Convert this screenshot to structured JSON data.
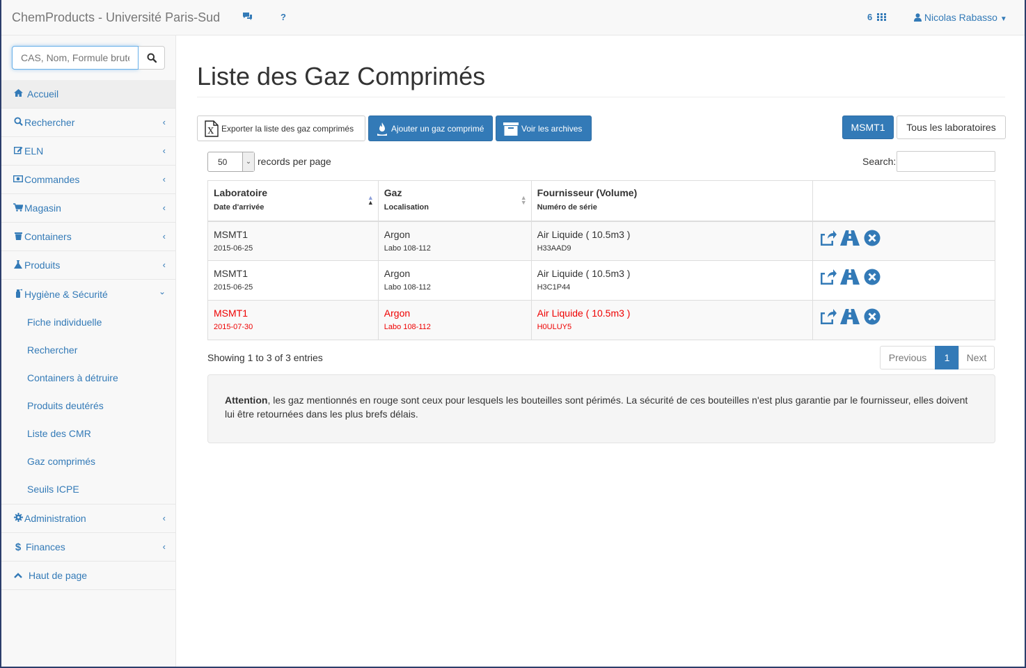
{
  "navbar": {
    "brand": "ChemProducts - Université Paris-Sud",
    "count": "6",
    "user": "Nicolas Rabasso",
    "accent": "#337ab7"
  },
  "sidebar": {
    "search_placeholder": "CAS, Nom, Formule brute",
    "items": [
      {
        "label": "Accueil",
        "icon": "home-icon"
      },
      {
        "label": "Rechercher",
        "icon": "search-icon"
      },
      {
        "label": "ELN",
        "icon": "edit-icon"
      },
      {
        "label": "Commandes",
        "icon": "money-icon"
      },
      {
        "label": "Magasin",
        "icon": "cart-icon"
      },
      {
        "label": "Containers",
        "icon": "bin-icon"
      },
      {
        "label": "Produits",
        "icon": "flask-icon"
      },
      {
        "label": "Hygiène & Sécurité",
        "icon": "extinguisher-icon"
      },
      {
        "label": "Administration",
        "icon": "gear-icon"
      },
      {
        "label": "Finances",
        "icon": "dollar-icon"
      },
      {
        "label": "Haut de page",
        "icon": "chevron-up-icon"
      }
    ],
    "sub_items": [
      "Fiche individuelle",
      "Rechercher",
      "Containers à détruire",
      "Produits deutérés",
      "Liste des CMR",
      "Gaz comprimés",
      "Seuils ICPE"
    ]
  },
  "main": {
    "title": "Liste des Gaz Comprimés",
    "btn_export": "Exporter la liste des gaz comprimés",
    "btn_add": "Ajouter un gaz comprimé",
    "btn_archives": "Voir les archives",
    "btn_lab": "MSMT1",
    "btn_all": "Tous les laboratoires",
    "records_value": "50",
    "records_label": "records per page",
    "search_label": "Search:",
    "columns": [
      {
        "title": "Laboratoire",
        "sub": "Date d'arrivée"
      },
      {
        "title": "Gaz",
        "sub": "Localisation"
      },
      {
        "title": "Fournisseur (Volume)",
        "sub": "Numéro de série"
      }
    ],
    "rows": [
      {
        "lab": "MSMT1",
        "date": "2015-06-25",
        "gaz": "Argon",
        "loc": "Labo 108-112",
        "fournisseur": "Air Liquide ( 10.5m3 )",
        "serie": "H33AAD9",
        "expired": false
      },
      {
        "lab": "MSMT1",
        "date": "2015-06-25",
        "gaz": "Argon",
        "loc": "Labo 108-112",
        "fournisseur": "Air Liquide ( 10.5m3 )",
        "serie": "H3C1P44",
        "expired": false
      },
      {
        "lab": "MSMT1",
        "date": "2015-07-30",
        "gaz": "Argon",
        "loc": "Labo 108-112",
        "fournisseur": "Air Liquide ( 10.5m3 )",
        "serie": "H0ULUY5",
        "expired": true
      }
    ],
    "info": "Showing 1 to 3 of 3 entries",
    "pager": {
      "prev": "Previous",
      "current": "1",
      "next": "Next"
    },
    "alert_strong": "Attention",
    "alert_text": ", les gaz mentionnés en rouge sont ceux pour lesquels les bouteilles sont périmés. La sécurité de ces bouteilles n'est plus garantie par le fournisseur, elles doivent lui être retournées dans les plus brefs délais."
  }
}
